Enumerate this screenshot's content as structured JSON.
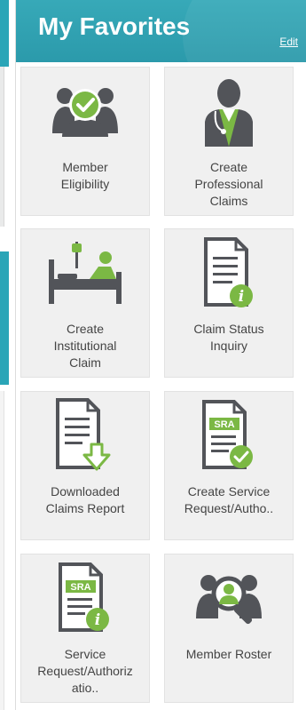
{
  "widget": {
    "title": "My Favorites",
    "edit_label": "Edit"
  },
  "colors": {
    "header": "#2b9aab",
    "icon_dark": "#525459",
    "icon_green": "#7bb844",
    "tile_bg": "#f0f0f0",
    "text": "#444444"
  },
  "tiles": [
    {
      "label": "Member\nEligibility",
      "icon": "people-check-icon"
    },
    {
      "label": "Create\nProfessional\nClaims",
      "icon": "doctor-icon"
    },
    {
      "label": "Create\nInstitutional\nClaim",
      "icon": "hospital-bed-icon"
    },
    {
      "label": "Claim Status\nInquiry",
      "icon": "document-info-icon"
    },
    {
      "label": "Downloaded\nClaims Report",
      "icon": "document-download-icon"
    },
    {
      "label": "Create Service\nRequest/Autho..",
      "icon": "sra-check-icon"
    },
    {
      "label": "Service\nRequest/Authoriz\natio..",
      "icon": "sra-info-icon"
    },
    {
      "label": "Member Roster",
      "icon": "people-search-icon"
    }
  ]
}
